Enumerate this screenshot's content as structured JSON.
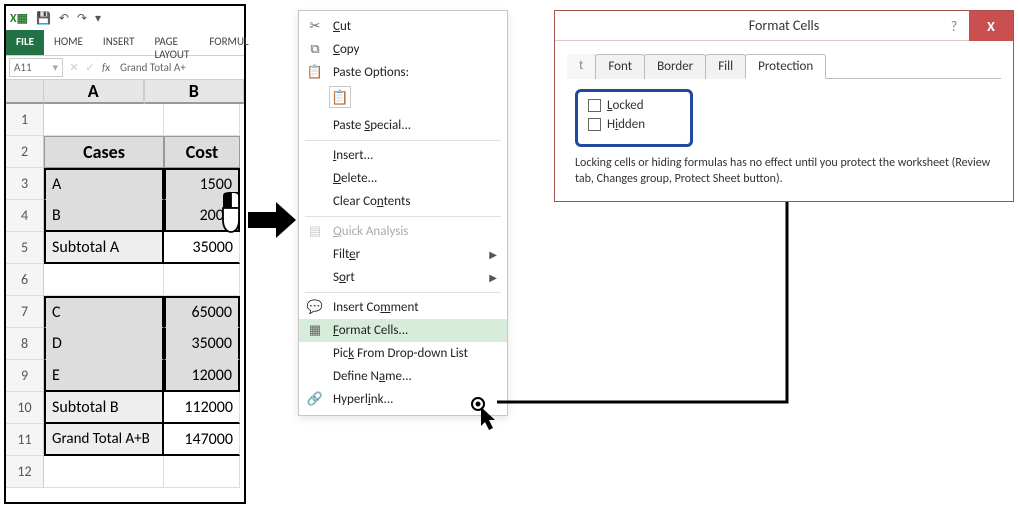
{
  "excel": {
    "ribbon": {
      "file": "FILE",
      "home": "HOME",
      "insert": "INSERT",
      "page_layout": "PAGE LAYOUT",
      "formulas": "FORMUL"
    },
    "namebox": "A11",
    "formula": "Grand Total A+",
    "col_headers": [
      "A",
      "B"
    ],
    "rows": [
      {
        "n": "1",
        "a": "",
        "b": ""
      },
      {
        "n": "2",
        "a": "Cases",
        "b": "Cost"
      },
      {
        "n": "3",
        "a": "A",
        "b": "1500"
      },
      {
        "n": "4",
        "a": "B",
        "b": "2000"
      },
      {
        "n": "5",
        "a": "Subtotal A",
        "b": "35000"
      },
      {
        "n": "6",
        "a": "",
        "b": ""
      },
      {
        "n": "7",
        "a": "C",
        "b": "65000"
      },
      {
        "n": "8",
        "a": "D",
        "b": "35000"
      },
      {
        "n": "9",
        "a": "E",
        "b": "12000"
      },
      {
        "n": "10",
        "a": "Subtotal B",
        "b": "112000"
      },
      {
        "n": "11",
        "a": "Grand Total A+B",
        "b": "147000"
      },
      {
        "n": "12",
        "a": "",
        "b": ""
      }
    ]
  },
  "ctx": {
    "cut": "Cut",
    "copy": "Copy",
    "paste_opts": "Paste Options:",
    "paste_special": "Paste Special...",
    "insert": "Insert...",
    "delete": "Delete...",
    "clear": "Clear Contents",
    "quick": "Quick Analysis",
    "filter": "Filter",
    "sort": "Sort",
    "comment": "Insert Comment",
    "format": "Format Cells...",
    "pick": "Pick From Drop-down List",
    "define": "Define Name...",
    "hyper": "Hyperlink..."
  },
  "dialog": {
    "title": "Format Cells",
    "tabs": {
      "partial": "t",
      "font": "Font",
      "border": "Border",
      "fill": "Fill",
      "protection": "Protection"
    },
    "locked": "Locked",
    "hidden": "Hidden",
    "info": "Locking cells or hiding formulas has no effect until you protect the worksheet (Review tab, Changes group, Protect Sheet button).",
    "help": "?",
    "close": "X"
  }
}
